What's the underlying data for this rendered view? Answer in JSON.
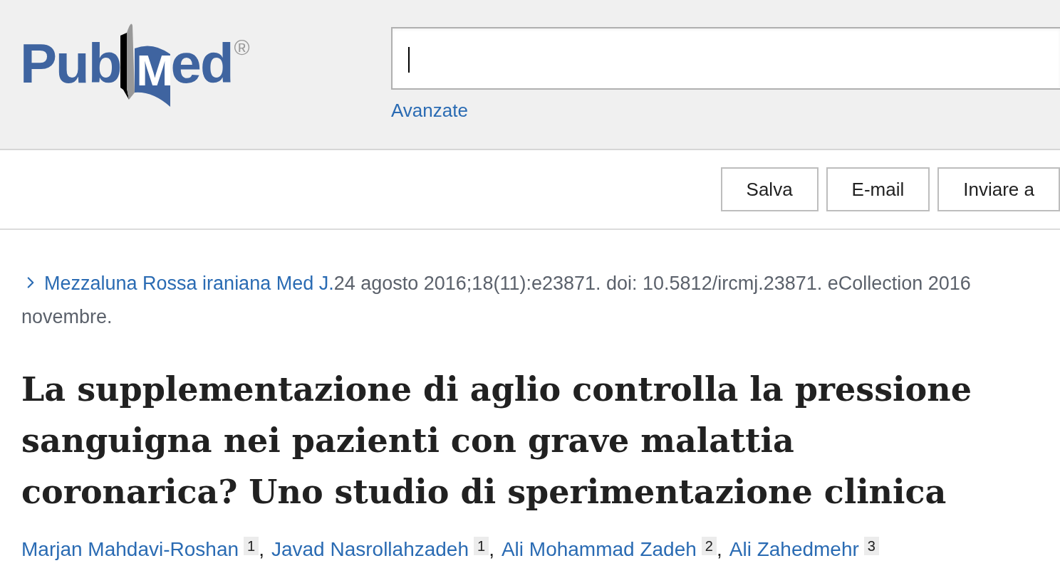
{
  "logo": {
    "left": "Pub",
    "book_letter": "M",
    "right": "ed",
    "mark": "®"
  },
  "search": {
    "advanced_link": "Avanzate"
  },
  "actions": [
    "Salva",
    "E-mail",
    "Inviare a"
  ],
  "citation": {
    "journal": "Mezzaluna Rossa iraniana Med J.",
    "details": "24 agosto 2016;18(11):e23871. doi: 10.5812/ircmj.23871. eCollection 2016 novembre."
  },
  "title": "La supplementazione di aglio controlla la pressione sanguigna nei pazienti con grave malattia coronarica? Uno studio di sperimentazione clinica",
  "authors": [
    {
      "name": "Marjan Mahdavi-Roshan",
      "affiliation": "1",
      "separator": ","
    },
    {
      "name": "Javad Nasrollahzadeh",
      "affiliation": "1",
      "separator": ","
    },
    {
      "name": "Ali Mohammad Zadeh",
      "affiliation": "2",
      "separator": ","
    },
    {
      "name": "Ali Zahedmehr",
      "affiliation": "3"
    }
  ]
}
